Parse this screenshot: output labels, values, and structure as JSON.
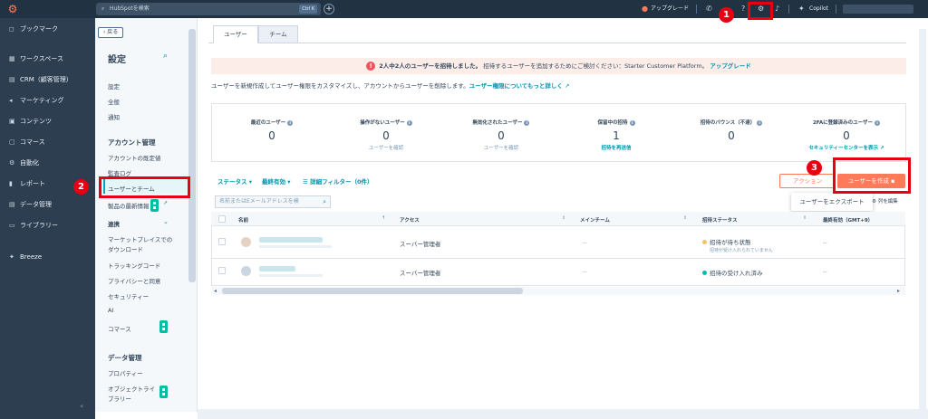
{
  "topbar": {
    "logo": "⚙",
    "search_placeholder": "HubSpotを検索",
    "search_shortcut": "Ctrl K",
    "plus": "+",
    "upgrade": "アップグレード",
    "copilot": "Copilot"
  },
  "leftnav": {
    "items": [
      {
        "icon": "◻",
        "label": "ブックマーク"
      },
      {
        "icon": "▦",
        "label": "ワークスペース"
      },
      {
        "icon": "▤",
        "label": "CRM（顧客管理）"
      },
      {
        "icon": "◂",
        "label": "マーケティング"
      },
      {
        "icon": "▣",
        "label": "コンテンツ"
      },
      {
        "icon": "▢",
        "label": "コマース"
      },
      {
        "icon": "⚙",
        "label": "自動化"
      },
      {
        "icon": "▮",
        "label": "レポート"
      },
      {
        "icon": "▤",
        "label": "データ管理"
      },
      {
        "icon": "▭",
        "label": "ライブラリー"
      },
      {
        "icon": "✦",
        "label": "Breeze"
      }
    ],
    "collapse": "«"
  },
  "settings": {
    "back": "‹ 戻る",
    "title": "設定",
    "items_top": [
      "設定",
      "全般",
      "通知"
    ],
    "account_head": "アカウント管理",
    "account_items": [
      "アカウントの既定値",
      "監査ログ",
      "ユーザーとチーム",
      "製品の最新情報"
    ],
    "integration_head": "連携",
    "integration_items": [
      "マーケットプレイスでの",
      "ダウンロード",
      "トラッキングコード",
      "プライバシーと同意",
      "セキュリティー",
      "AI",
      "コマース"
    ],
    "data_head": "データ管理",
    "data_items": [
      "プロパティー",
      "オブジェクトライ",
      "ブラリー"
    ]
  },
  "tabs": [
    "ユーザー",
    "チーム"
  ],
  "banner": {
    "bold": "2人中2人のユーザーを招待しました。",
    "text": "招待するユーザーを追加するためにご検討ください：Starter Customer Platform。",
    "link": "アップグレード"
  },
  "description": {
    "text": "ユーザーを新規作成してユーザー権限をカスタマイズし、アカウントからユーザーを削除します。",
    "link": "ユーザー権限についてもっと詳しく"
  },
  "stats": [
    {
      "label": "最近のユーザー",
      "value": "0",
      "link": ""
    },
    {
      "label": "操作がないユーザー",
      "value": "0",
      "link": "ユーザーを確認"
    },
    {
      "label": "無効化されたユーザー",
      "value": "0",
      "link": "ユーザーを確認"
    },
    {
      "label": "保留中の招待",
      "value": "1",
      "link": "招待を再送信"
    },
    {
      "label": "招待のバウンス（不達）",
      "value": "0",
      "link": ""
    },
    {
      "label": "2FAに登録済みのユーザー",
      "value": "0",
      "link": "セキュリティーセンターを表示"
    }
  ],
  "filters": {
    "status": "ステータス",
    "last_active": "最終有効",
    "advanced": "詳細フィルター（0件）"
  },
  "actions": {
    "action": "アクション",
    "create": "ユーザーを作成",
    "export": "ユーザーをエクスポート",
    "edit_columns": "列を編集"
  },
  "table": {
    "search_placeholder": "名前またはEメールアドレスを検",
    "headers": [
      "名前",
      "アクセス",
      "メインチーム",
      "招待ステータス",
      "最終有効（GMT+9）"
    ],
    "rows": [
      {
        "access": "スーパー管理者",
        "team": "--",
        "status": "招待が待ち状態",
        "status_sub": "招待が受け入れられていません",
        "status_color": "#f5c26b",
        "last": "--"
      },
      {
        "access": "スーパー管理者",
        "team": "--",
        "status": "招待の受け入れ済み",
        "status_sub": "",
        "status_color": "#00bda5",
        "last": "--"
      }
    ]
  },
  "callouts": [
    "1",
    "2",
    "3"
  ],
  "colors": {
    "accent": "#ff7a59",
    "link": "#0091ae",
    "callout": "#e60012"
  }
}
